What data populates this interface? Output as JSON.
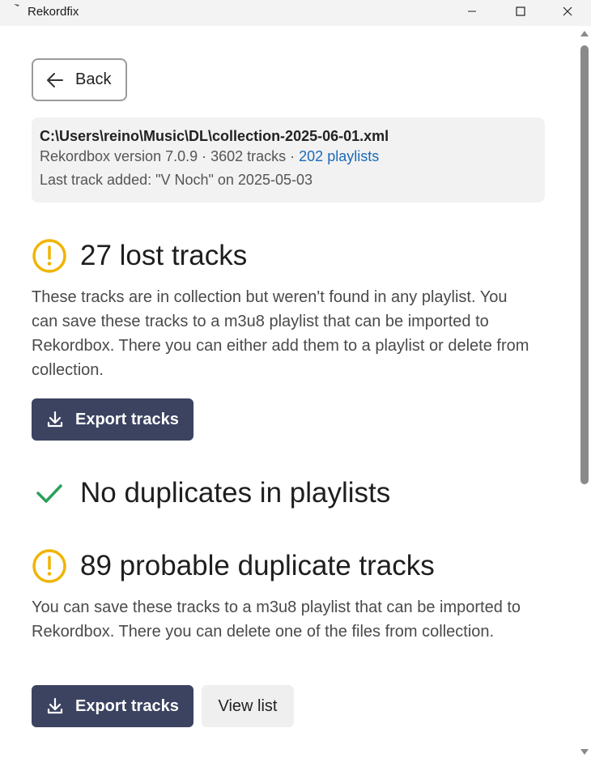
{
  "window": {
    "title": "Rekordfix"
  },
  "back_button": {
    "label": "Back"
  },
  "collection": {
    "path": "C:\\Users\\reino\\Music\\DL\\collection-2025-06-01.xml",
    "version_text": "Rekordbox version 7.0.9 · 3602 tracks · ",
    "playlists_link": "202 playlists",
    "last_added": "Last track added: \"V Noch\" on 2025-05-03"
  },
  "lost_tracks": {
    "heading": "27 lost tracks",
    "status_icon": "warning-icon",
    "description": "These tracks are in collection but weren't found in any playlist. You can save these tracks to a m3u8 playlist that can be imported to Rekordbox. There you can either add them to a playlist or delete from collection.",
    "export_label": "Export tracks"
  },
  "playlist_duplicates": {
    "heading": "No duplicates in playlists",
    "status_icon": "check-icon"
  },
  "probable_duplicates": {
    "heading": "89 probable duplicate tracks",
    "status_icon": "warning-icon",
    "description": "You can save these tracks to a m3u8 playlist that can be imported to Rekordbox. There you can delete one of the files from collection.",
    "export_label": "Export tracks",
    "view_label": "View list"
  },
  "colors": {
    "warning": "#f0b400",
    "success": "#2aa05a",
    "primary_button": "#3b4361",
    "link": "#1a6aba"
  }
}
